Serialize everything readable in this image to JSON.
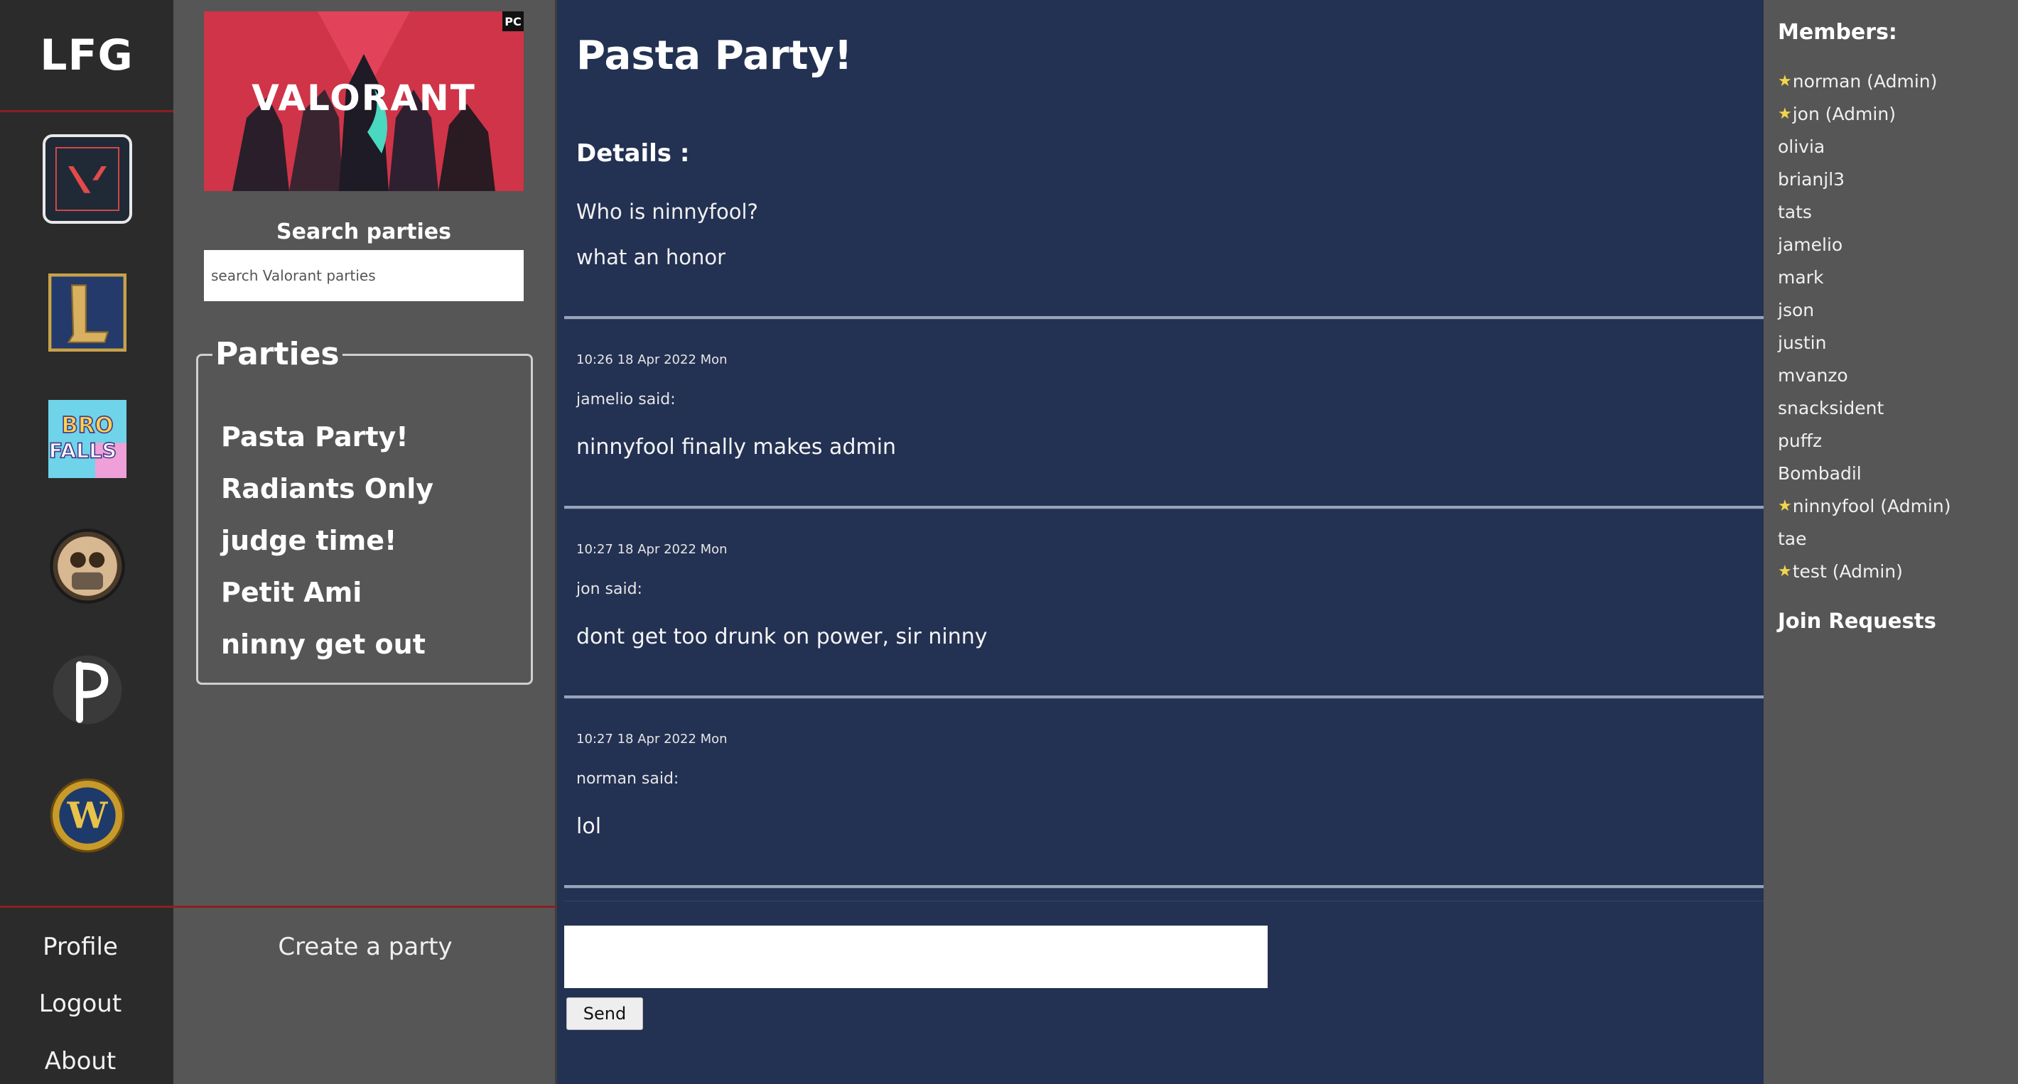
{
  "rail": {
    "logo": "LFG",
    "games": [
      "valorant-icon",
      "league-of-legends-icon",
      "bro-falls-icon",
      "dont-starve-together-icon",
      "p-game-icon",
      "world-of-warcraft-icon"
    ],
    "links": {
      "profile": "Profile",
      "logout": "Logout",
      "about": "About"
    }
  },
  "party_column": {
    "banner": {
      "title": "VALORANT",
      "platform": "PC"
    },
    "search_label": "Search parties",
    "search_placeholder": "search Valorant parties",
    "parties_title": "Parties",
    "parties": [
      "Pasta Party!",
      "Radiants Only",
      "judge time!",
      "Petit Ami",
      "ninny get out"
    ],
    "create_party": "Create a party"
  },
  "main": {
    "title": "Pasta Party!",
    "details_label": "Details :",
    "details": [
      "Who is ninnyfool?",
      "what an honor"
    ],
    "messages": [
      {
        "time": "10:26 18 Apr 2022 Mon",
        "author": "jamelio said:",
        "text": "ninnyfool finally makes admin"
      },
      {
        "time": "10:27 18 Apr 2022 Mon",
        "author": "jon said:",
        "text": "dont get too drunk on power, sir ninny"
      },
      {
        "time": "10:27 18 Apr 2022 Mon",
        "author": "norman said:",
        "text": "lol"
      }
    ],
    "composer": {
      "value": "",
      "send_label": "Send"
    }
  },
  "members": {
    "title": "Members:",
    "list": [
      {
        "name": "norman (Admin)",
        "admin": true
      },
      {
        "name": "jon (Admin)",
        "admin": true
      },
      {
        "name": "olivia",
        "admin": false
      },
      {
        "name": "brianjl3",
        "admin": false
      },
      {
        "name": "tats",
        "admin": false
      },
      {
        "name": "jamelio",
        "admin": false
      },
      {
        "name": "mark",
        "admin": false
      },
      {
        "name": "json",
        "admin": false
      },
      {
        "name": "justin",
        "admin": false
      },
      {
        "name": "mvanzo",
        "admin": false
      },
      {
        "name": "snacksident",
        "admin": false
      },
      {
        "name": "puffz",
        "admin": false
      },
      {
        "name": "Bombadil",
        "admin": false
      },
      {
        "name": "ninnyfool (Admin)",
        "admin": true
      },
      {
        "name": "tae",
        "admin": false
      },
      {
        "name": "test (Admin)",
        "admin": true
      }
    ],
    "join_requests": "Join Requests"
  },
  "colors": {
    "rail": "#2b2b2b",
    "panel": "#565656",
    "chat": "#233152",
    "accent": "#8a1f22"
  }
}
